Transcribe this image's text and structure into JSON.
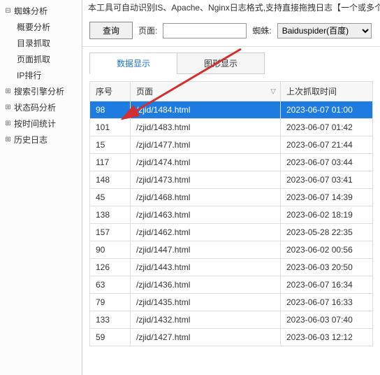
{
  "top_text": "本工具可自动识别IS、Apache、Nginx日志格式,支持直接拖拽日志【一个或多个文件(夹)】至本窗口...",
  "sidebar": {
    "items": [
      {
        "label": "蜘蛛分析",
        "expanded": true,
        "children": [
          {
            "label": "概要分析"
          },
          {
            "label": "目录抓取"
          },
          {
            "label": "页面抓取"
          },
          {
            "label": "IP排行"
          }
        ]
      },
      {
        "label": "搜索引擎分析",
        "expanded": false
      },
      {
        "label": "状态码分析",
        "expanded": false
      },
      {
        "label": "按时间统计",
        "expanded": false
      },
      {
        "label": "历史日志",
        "expanded": false
      }
    ]
  },
  "filter": {
    "query_btn": "查询",
    "page_label": "页面:",
    "page_value": "",
    "spider_label": "蜘蛛:",
    "spider_value": "Baiduspider(百度)"
  },
  "tabs": [
    {
      "label": "数据显示",
      "active": true
    },
    {
      "label": "图形显示",
      "active": false
    }
  ],
  "table": {
    "headers": {
      "seq": "序号",
      "page": "页面",
      "time": "上次抓取时间"
    },
    "rows": [
      {
        "seq": "98",
        "page": "/zjid/1484.html",
        "time": "2023-06-07 01:00",
        "selected": true
      },
      {
        "seq": "101",
        "page": "/zjid/1483.html",
        "time": "2023-06-07 01:42"
      },
      {
        "seq": "15",
        "page": "/zjid/1477.html",
        "time": "2023-06-07 21:44"
      },
      {
        "seq": "117",
        "page": "/zjid/1474.html",
        "time": "2023-06-07 03:44"
      },
      {
        "seq": "148",
        "page": "/zjid/1473.html",
        "time": "2023-06-07 03:41"
      },
      {
        "seq": "45",
        "page": "/zjid/1468.html",
        "time": "2023-06-07 14:39"
      },
      {
        "seq": "138",
        "page": "/zjid/1463.html",
        "time": "2023-06-02 18:19"
      },
      {
        "seq": "157",
        "page": "/zjid/1462.html",
        "time": "2023-05-28 22:35"
      },
      {
        "seq": "90",
        "page": "/zjid/1447.html",
        "time": "2023-06-02 00:56"
      },
      {
        "seq": "126",
        "page": "/zjid/1443.html",
        "time": "2023-06-03 20:50"
      },
      {
        "seq": "63",
        "page": "/zjid/1436.html",
        "time": "2023-06-07 16:34"
      },
      {
        "seq": "79",
        "page": "/zjid/1435.html",
        "time": "2023-06-07 16:33"
      },
      {
        "seq": "133",
        "page": "/zjid/1432.html",
        "time": "2023-06-03 07:40"
      },
      {
        "seq": "59",
        "page": "/zjid/1427.html",
        "time": "2023-06-03 12:12"
      }
    ]
  }
}
